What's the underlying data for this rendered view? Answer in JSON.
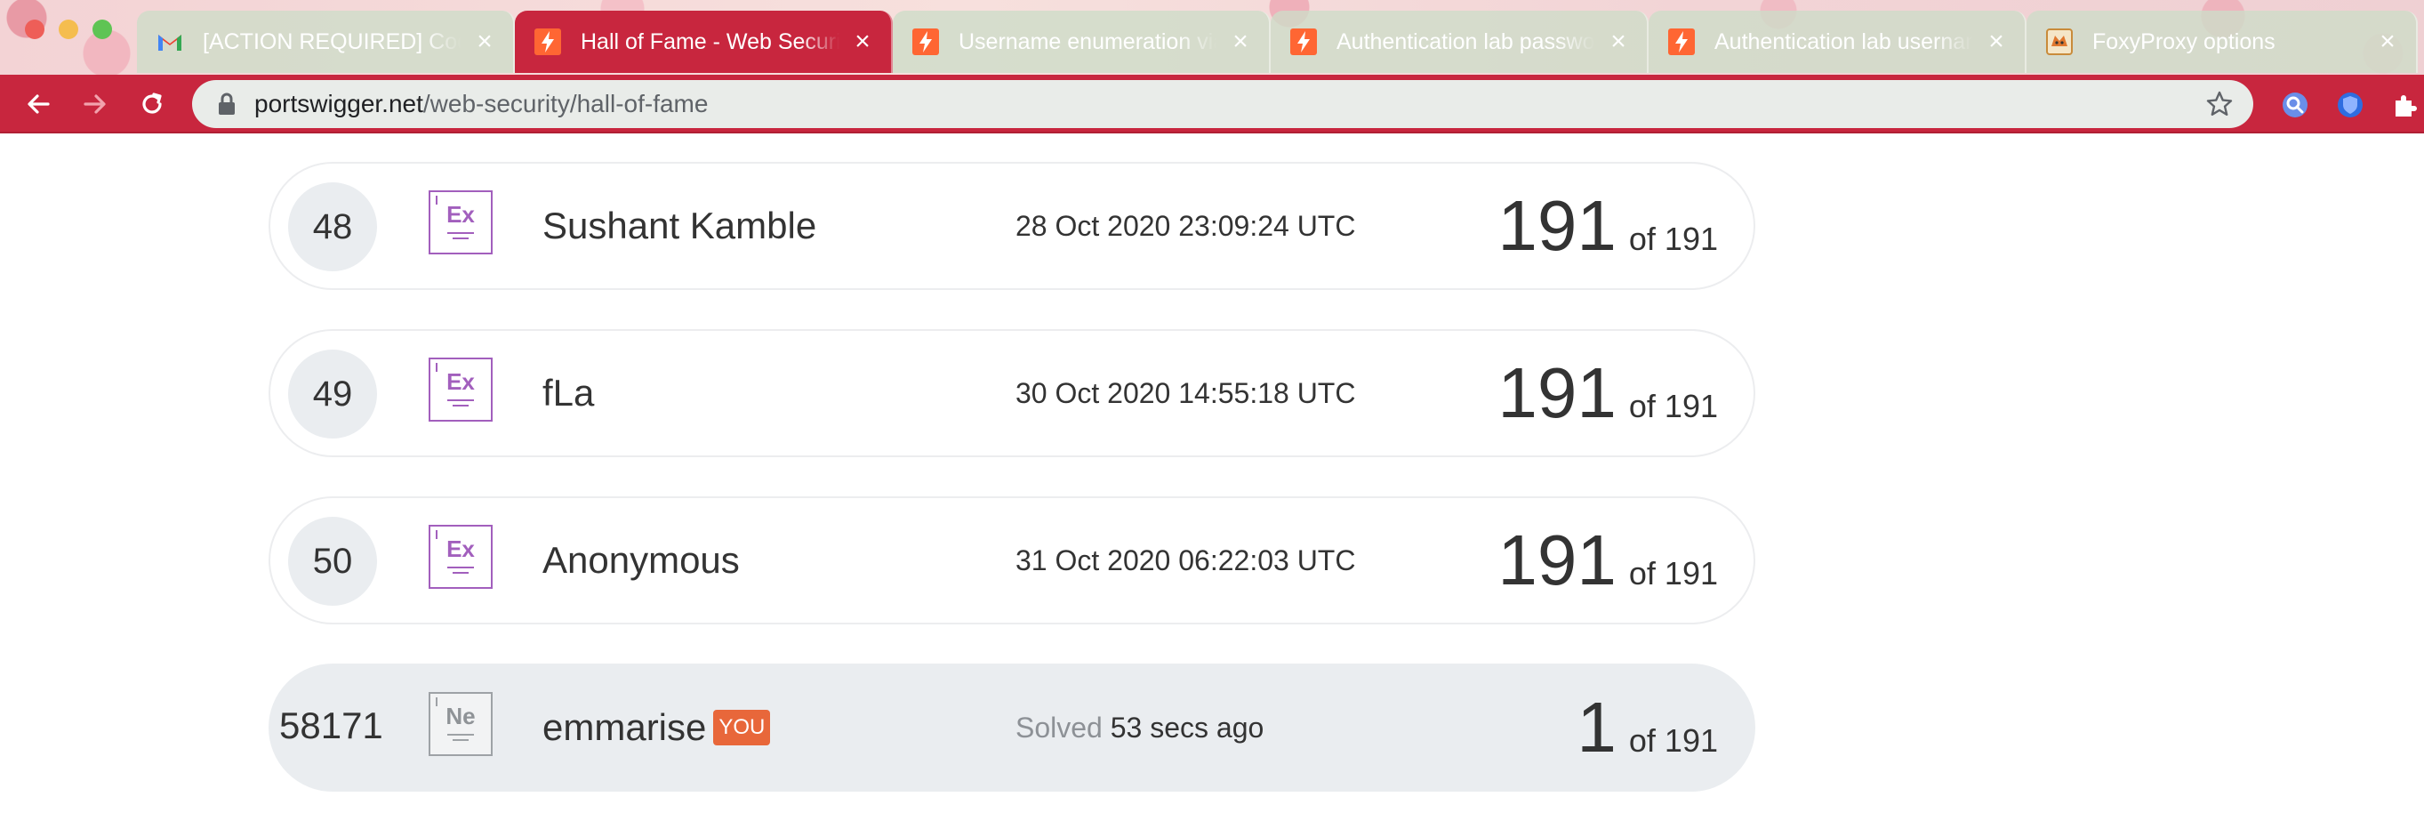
{
  "browser": {
    "tabs": [
      {
        "title": "[ACTION REQUIRED] Code",
        "favicon": "gmail-icon",
        "active": false
      },
      {
        "title": "Hall of Fame - Web Security",
        "favicon": "portswigger-icon",
        "active": true
      },
      {
        "title": "Username enumeration via",
        "favicon": "portswigger-icon",
        "active": false
      },
      {
        "title": "Authentication lab passwords",
        "favicon": "portswigger-icon",
        "active": false
      },
      {
        "title": "Authentication lab usernames",
        "favicon": "portswigger-icon",
        "active": false
      },
      {
        "title": "FoxyProxy options",
        "favicon": "foxyproxy-icon",
        "active": false
      }
    ],
    "address": {
      "host": "portswigger.net",
      "path": "/web-security/hall-of-fame"
    }
  },
  "leaderboard": {
    "rows": [
      {
        "rank": "48",
        "badge": "Ex",
        "name": "Sushant Kamble",
        "date": "28 Oct 2020 23:09:24 UTC",
        "score": "191",
        "of": "of 191"
      },
      {
        "rank": "49",
        "badge": "Ex",
        "name": "fLa",
        "date": "30 Oct 2020 14:55:18 UTC",
        "score": "191",
        "of": "of 191"
      },
      {
        "rank": "50",
        "badge": "Ex",
        "name": "Anonymous",
        "date": "31 Oct 2020 06:22:03 UTC",
        "score": "191",
        "of": "of 191"
      }
    ],
    "you": {
      "rank": "58171",
      "badge": "Ne",
      "name": "emmarise",
      "tag": "YOU",
      "solved_label": "Solved",
      "solved_time": "53 secs ago",
      "score": "1",
      "of": "of 191"
    }
  },
  "colors": {
    "accent": "#c8263e",
    "expert_badge": "#a25fbd",
    "you_tag": "#e8673a"
  }
}
